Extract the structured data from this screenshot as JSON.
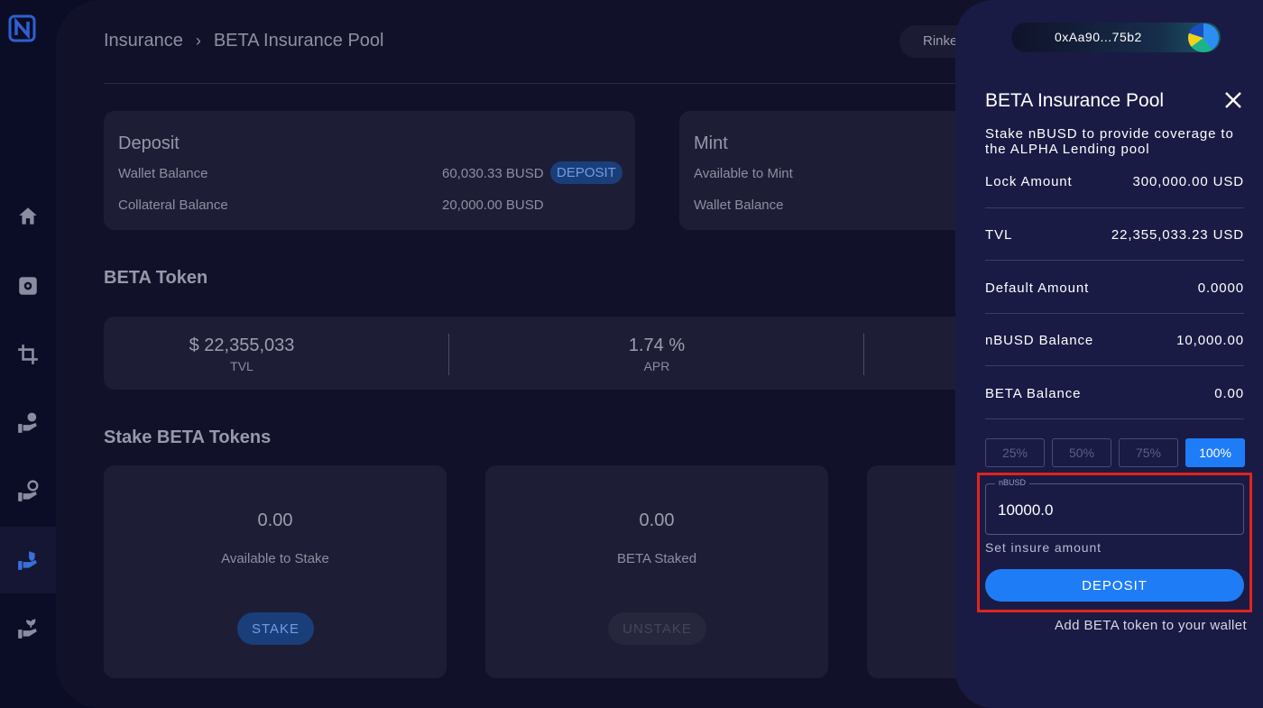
{
  "breadcrumb": {
    "root": "Insurance",
    "current": "BETA Insurance Pool"
  },
  "network": {
    "label": "Rinke"
  },
  "deposit_card": {
    "title": "Deposit",
    "rows": [
      {
        "label": "Wallet Balance",
        "value": "60,030.33 BUSD",
        "button": "DEPOSIT"
      },
      {
        "label": "Collateral Balance",
        "value": "20,000.00 BUSD"
      }
    ]
  },
  "mint_card": {
    "title": "Mint",
    "rows": [
      {
        "label": "Available to Mint"
      },
      {
        "label": "Wallet Balance"
      }
    ]
  },
  "beta_token": {
    "heading": "BETA Token",
    "stats": [
      {
        "value": "$ 22,355,033",
        "label": "TVL"
      },
      {
        "value": "1.74 %",
        "label": "APR"
      }
    ]
  },
  "stake": {
    "heading": "Stake BETA Tokens",
    "cards": [
      {
        "value": "0.00",
        "label": "Available to Stake",
        "button": "STAKE"
      },
      {
        "value": "0.00",
        "label": "BETA Staked",
        "button": "UNSTAKE"
      }
    ]
  },
  "drawer": {
    "wallet_address": "0xAa90...75b2",
    "title": "BETA Insurance Pool",
    "description": "Stake nBUSD to provide coverage to the ALPHA Lending pool",
    "rows": [
      {
        "label": "Lock Amount",
        "value": "300,000.00 USD"
      },
      {
        "label": "TVL",
        "value": "22,355,033.23 USD"
      },
      {
        "label": "Default Amount",
        "value": "0.0000"
      },
      {
        "label": "nBUSD Balance",
        "value": "10,000.00"
      },
      {
        "label": "BETA Balance",
        "value": "0.00"
      }
    ],
    "percent_options": [
      "25%",
      "50%",
      "75%",
      "100%"
    ],
    "selected_percent": "100%",
    "input": {
      "legend": "nBUSD",
      "value": "10000.0"
    },
    "helper_text": "Set insure amount",
    "deposit_button": "DEPOSIT",
    "add_token_link": "Add BETA token to your wallet"
  },
  "colors": {
    "accent": "#1f7cf7",
    "highlight": "#e0241b",
    "drawer_bg": "#1a1b44",
    "page_bg": "#0b0c26"
  },
  "icons": [
    "logo",
    "home-icon",
    "vault-icon",
    "crop-icon",
    "hand-coin-icon",
    "hand-gear-icon",
    "hand-shield-icon",
    "hand-plant-icon",
    "close-icon"
  ]
}
